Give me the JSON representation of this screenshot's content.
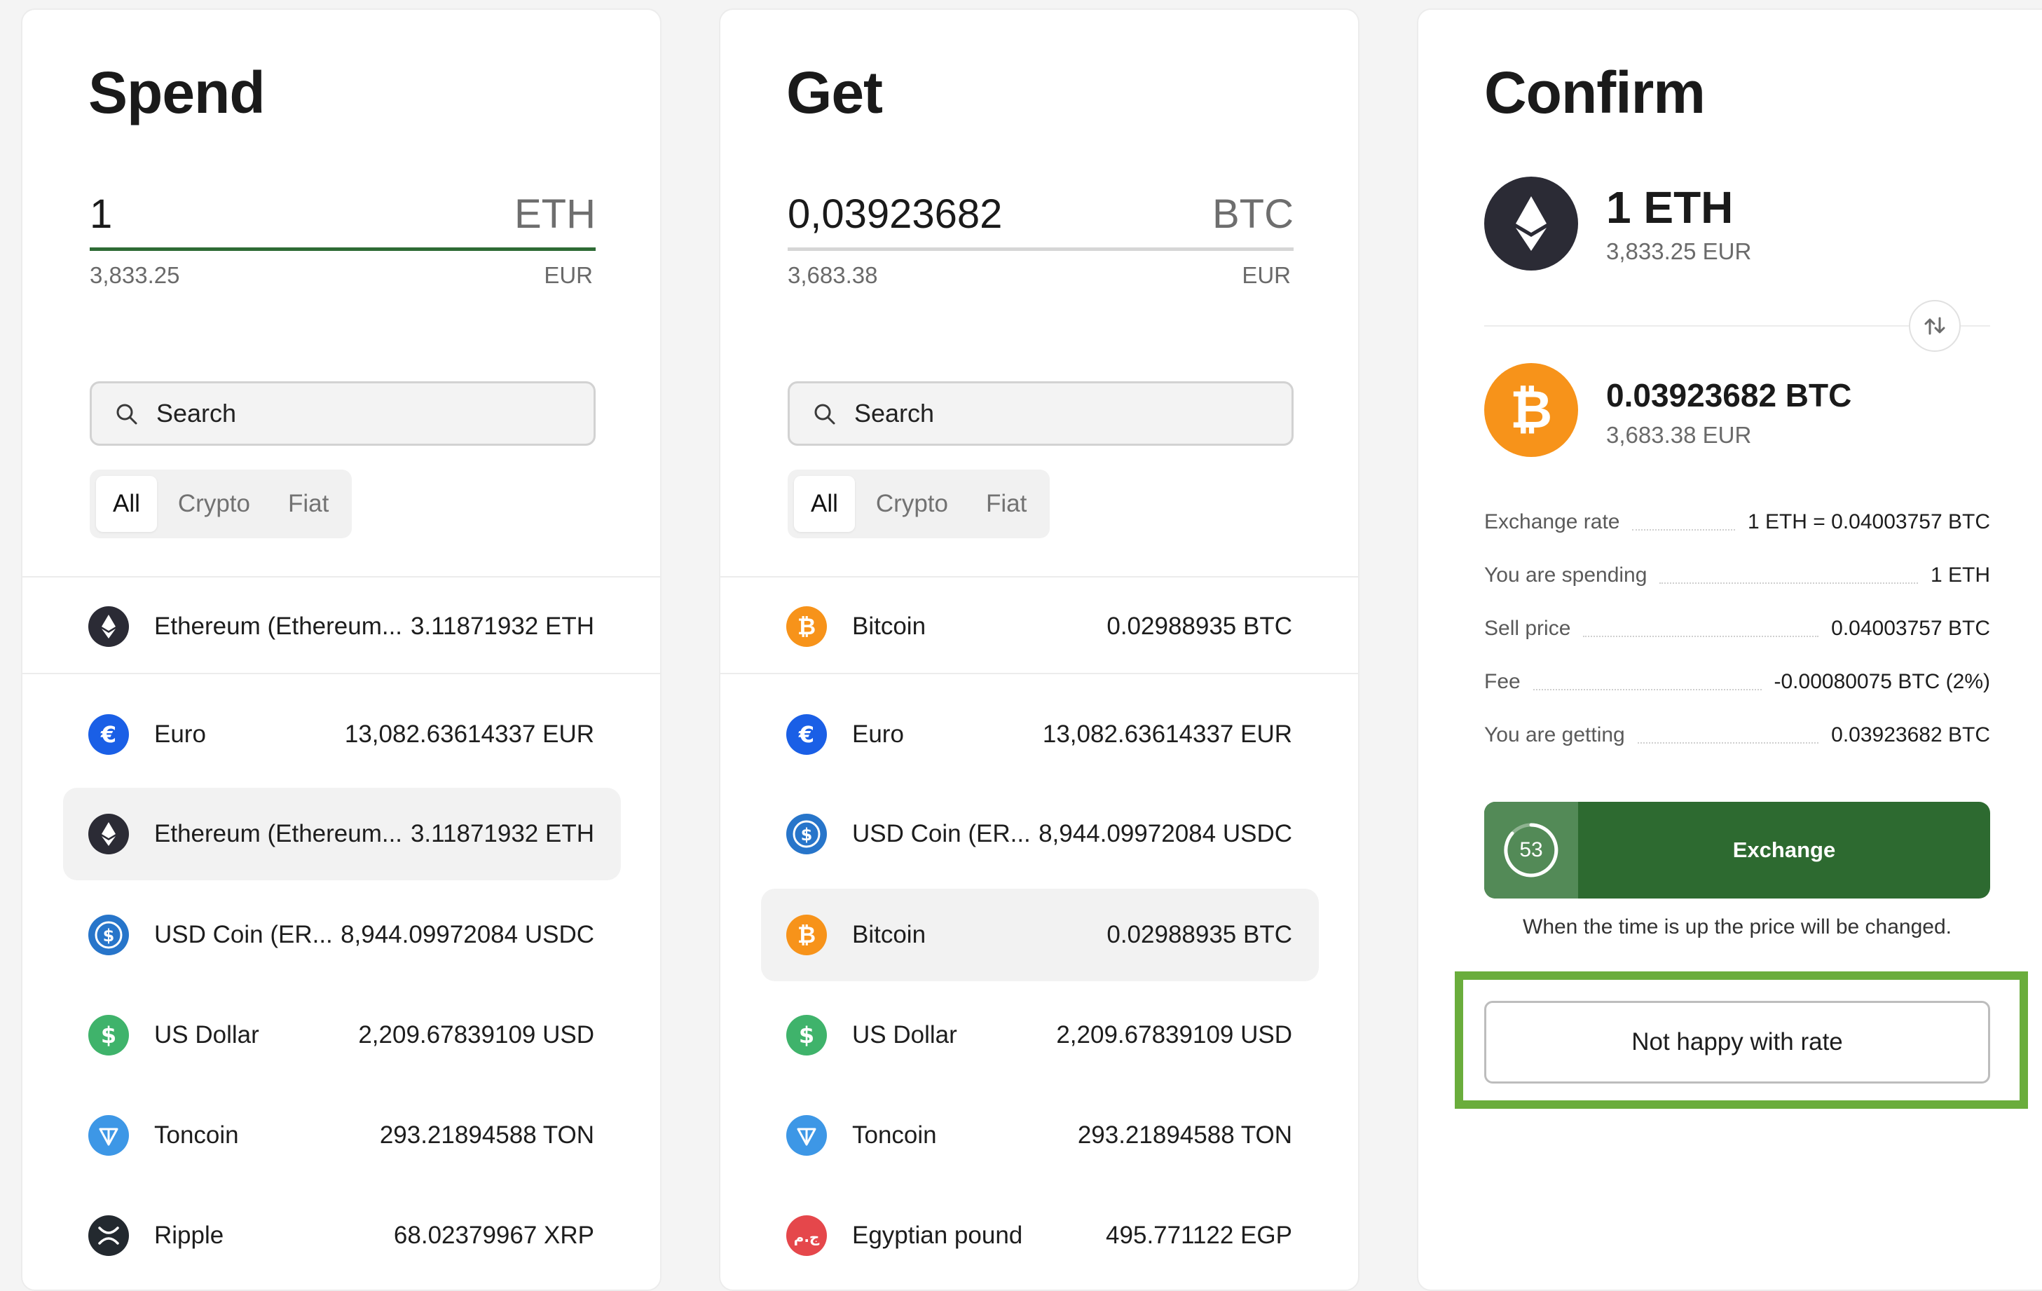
{
  "spend": {
    "title": "Spend",
    "amount": "1",
    "amount_unit": "ETH",
    "fiat_value": "3,833.25",
    "fiat_unit": "EUR",
    "search_placeholder": "Search",
    "filters": [
      "All",
      "Crypto",
      "Fiat"
    ],
    "active_filter": "All",
    "pinned": {
      "name": "Ethereum (Ethereum...",
      "balance": "3.11871932 ETH",
      "icon": "ethereum-icon"
    },
    "assets": [
      {
        "name": "Euro",
        "balance": "13,082.63614337 EUR",
        "icon": "euro-icon",
        "selected": false
      },
      {
        "name": "Ethereum (Ethereum...",
        "balance": "3.11871932 ETH",
        "icon": "ethereum-icon",
        "selected": true
      },
      {
        "name": "USD Coin (ER...",
        "balance": "8,944.09972084 USDC",
        "icon": "usd-coin-icon",
        "selected": false
      },
      {
        "name": "US Dollar",
        "balance": "2,209.67839109 USD",
        "icon": "us-dollar-icon",
        "selected": false
      },
      {
        "name": "Toncoin",
        "balance": "293.21894588 TON",
        "icon": "toncoin-icon",
        "selected": false
      },
      {
        "name": "Ripple",
        "balance": "68.02379967 XRP",
        "icon": "ripple-icon",
        "selected": false
      }
    ]
  },
  "get": {
    "title": "Get",
    "amount": "0,03923682",
    "amount_unit": "BTC",
    "fiat_value": "3,683.38",
    "fiat_unit": "EUR",
    "search_placeholder": "Search",
    "filters": [
      "All",
      "Crypto",
      "Fiat"
    ],
    "active_filter": "All",
    "pinned": {
      "name": "Bitcoin",
      "balance": "0.02988935 BTC",
      "icon": "bitcoin-icon"
    },
    "assets": [
      {
        "name": "Euro",
        "balance": "13,082.63614337 EUR",
        "icon": "euro-icon",
        "selected": false
      },
      {
        "name": "USD Coin (ER...",
        "balance": "8,944.09972084 USDC",
        "icon": "usd-coin-icon",
        "selected": false
      },
      {
        "name": "Bitcoin",
        "balance": "0.02988935 BTC",
        "icon": "bitcoin-icon",
        "selected": true
      },
      {
        "name": "US Dollar",
        "balance": "2,209.67839109 USD",
        "icon": "us-dollar-icon",
        "selected": false
      },
      {
        "name": "Toncoin",
        "balance": "293.21894588 TON",
        "icon": "toncoin-icon",
        "selected": false
      },
      {
        "name": "Egyptian pound",
        "balance": "495.771122 EGP",
        "icon": "egyptian-pound-icon",
        "selected": false
      }
    ]
  },
  "confirm": {
    "title": "Confirm",
    "from_amount": "1 ETH",
    "from_fiat": "3,833.25 EUR",
    "to_amount": "0.03923682 BTC",
    "to_fiat": "3,683.38 EUR",
    "details": [
      {
        "label": "Exchange rate",
        "value": "1 ETH = 0.04003757 BTC"
      },
      {
        "label": "You are spending",
        "value": "1 ETH"
      },
      {
        "label": "Sell price",
        "value": "0.04003757 BTC"
      },
      {
        "label": "Fee",
        "value": "-0.00080075 BTC (2%)"
      },
      {
        "label": "You are getting",
        "value": "0.03923682 BTC"
      }
    ],
    "timer": "53",
    "exchange_label": "Exchange",
    "timer_note": "When the time is up the price will be changed.",
    "not_happy_label": "Not happy with rate"
  },
  "colors": {
    "accent_green": "#2d6a30",
    "timer_green": "#538a57",
    "highlight_green": "#6aad3c",
    "ethereum": "#2b2b35",
    "bitcoin": "#f7931a",
    "euro": "#1a5fe6",
    "usd_coin": "#2775ca",
    "us_dollar": "#3fb36b",
    "toncoin": "#3d97e6",
    "ripple": "#23292f",
    "egyptian_pound": "#e5474b"
  }
}
